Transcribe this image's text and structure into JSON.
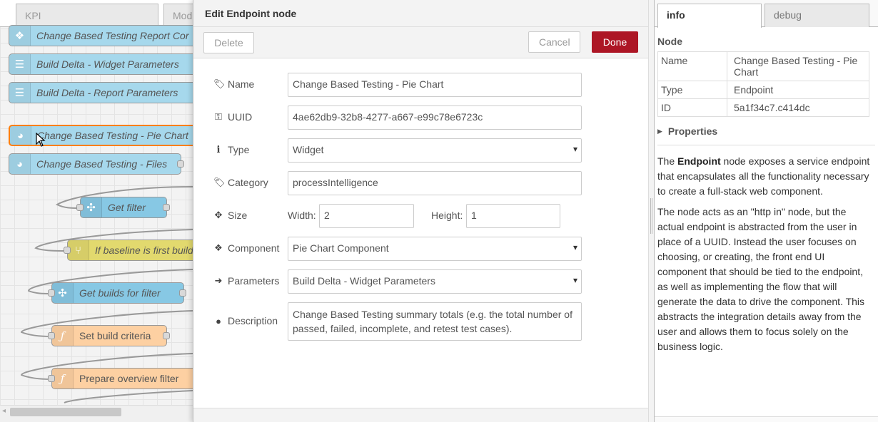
{
  "workspace": {
    "tabs": [
      "KPI",
      "Mod"
    ],
    "nodes": [
      {
        "label": "Change Based Testing Report Cor",
        "icon": "network"
      },
      {
        "label": "Build Delta - Widget Parameters",
        "icon": "list"
      },
      {
        "label": "Build Delta - Report Parameters",
        "icon": "list"
      },
      {
        "label": "Change Based Testing - Pie Chart",
        "icon": "globe"
      },
      {
        "label": "Change Based Testing - Files",
        "icon": "globe"
      },
      {
        "label": "Get filter",
        "icon": "puzzle"
      },
      {
        "label": "If baseline is first build",
        "icon": "switch"
      },
      {
        "label": "Get builds for filter",
        "icon": "puzzle"
      },
      {
        "label": "Set build criteria",
        "icon": "function"
      },
      {
        "label": "Prepare overview filter",
        "icon": "function"
      }
    ]
  },
  "dialog": {
    "title": "Edit Endpoint node",
    "delete_label": "Delete",
    "cancel_label": "Cancel",
    "done_label": "Done",
    "fields": {
      "name": {
        "label": "Name",
        "value": "Change Based Testing - Pie Chart",
        "icon": "tag-icon"
      },
      "uuid": {
        "label": "UUID",
        "value": "4ae62db9-32b8-4277-a667-e99c78e6723c",
        "icon": "key-icon"
      },
      "type": {
        "label": "Type",
        "value": "Widget",
        "icon": "info-icon"
      },
      "category": {
        "label": "Category",
        "value": "processIntelligence",
        "icon": "tags-icon"
      },
      "size": {
        "label": "Size",
        "width_label": "Width:",
        "width_value": "2",
        "height_label": "Height:",
        "height_value": "1",
        "icon": "arrows-icon"
      },
      "component": {
        "label": "Component",
        "value": "Pie Chart Component",
        "icon": "cubes-icon"
      },
      "parameters": {
        "label": "Parameters",
        "value": "Build Delta - Widget Parameters",
        "icon": "sign-in-icon"
      },
      "description": {
        "label": "Description",
        "value": "Change Based Testing summary totals (e.g. the total number of passed, failed, incomplete, and retest test cases).",
        "icon": "comment-icon"
      }
    }
  },
  "sidebar": {
    "tabs": {
      "info": "info",
      "debug": "debug"
    },
    "node_heading": "Node",
    "rows": [
      {
        "key": "Name",
        "value": "Change Based Testing - Pie Chart"
      },
      {
        "key": "Type",
        "value": "Endpoint"
      },
      {
        "key": "ID",
        "value": "5a1f34c7.c414dc"
      }
    ],
    "properties_label": "Properties",
    "desc1_pre": "The ",
    "desc1_bold": "Endpoint",
    "desc1_post": " node exposes a service endpoint that encapsulates all the functionality necessary to create a full-stack web component.",
    "desc2": "The node acts as an \"http in\" node, but the actual endpoint is abstracted from the user in place of a UUID. Instead the user focuses on choosing, or creating, the front end UI component that should be tied to the endpoint, as well as implementing the flow that will generate the data to drive the component. This abstracts the integration details away from the user and allows them to focus solely on the business logic."
  }
}
